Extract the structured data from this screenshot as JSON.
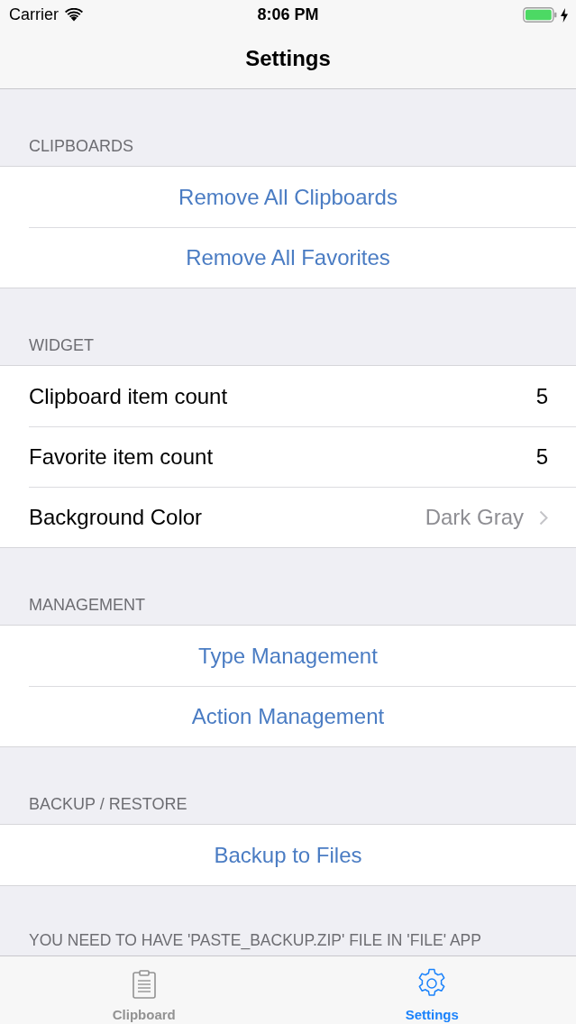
{
  "status_bar": {
    "carrier": "Carrier",
    "time": "8:06 PM"
  },
  "nav_bar": {
    "title": "Settings"
  },
  "sections": [
    {
      "header": "CLIPBOARDS",
      "rows": [
        {
          "kind": "action",
          "label": "Remove All Clipboards"
        },
        {
          "kind": "action",
          "label": "Remove All Favorites"
        }
      ]
    },
    {
      "header": "WIDGET",
      "rows": [
        {
          "kind": "value",
          "label": "Clipboard item count",
          "value": "5"
        },
        {
          "kind": "value",
          "label": "Favorite item count",
          "value": "5"
        },
        {
          "kind": "disclosure",
          "label": "Background Color",
          "value": "Dark Gray"
        }
      ]
    },
    {
      "header": "MANAGEMENT",
      "rows": [
        {
          "kind": "action",
          "label": "Type Management"
        },
        {
          "kind": "action",
          "label": "Action Management"
        }
      ]
    },
    {
      "header": "BACKUP / RESTORE",
      "rows": [
        {
          "kind": "action",
          "label": "Backup to Files"
        }
      ],
      "footer": "YOU NEED TO HAVE 'PASTE_BACKUP.ZIP' FILE IN 'FILE' APP"
    }
  ],
  "tab_bar": {
    "items": [
      {
        "label": "Clipboard",
        "selected": false
      },
      {
        "label": "Settings",
        "selected": true
      }
    ]
  }
}
